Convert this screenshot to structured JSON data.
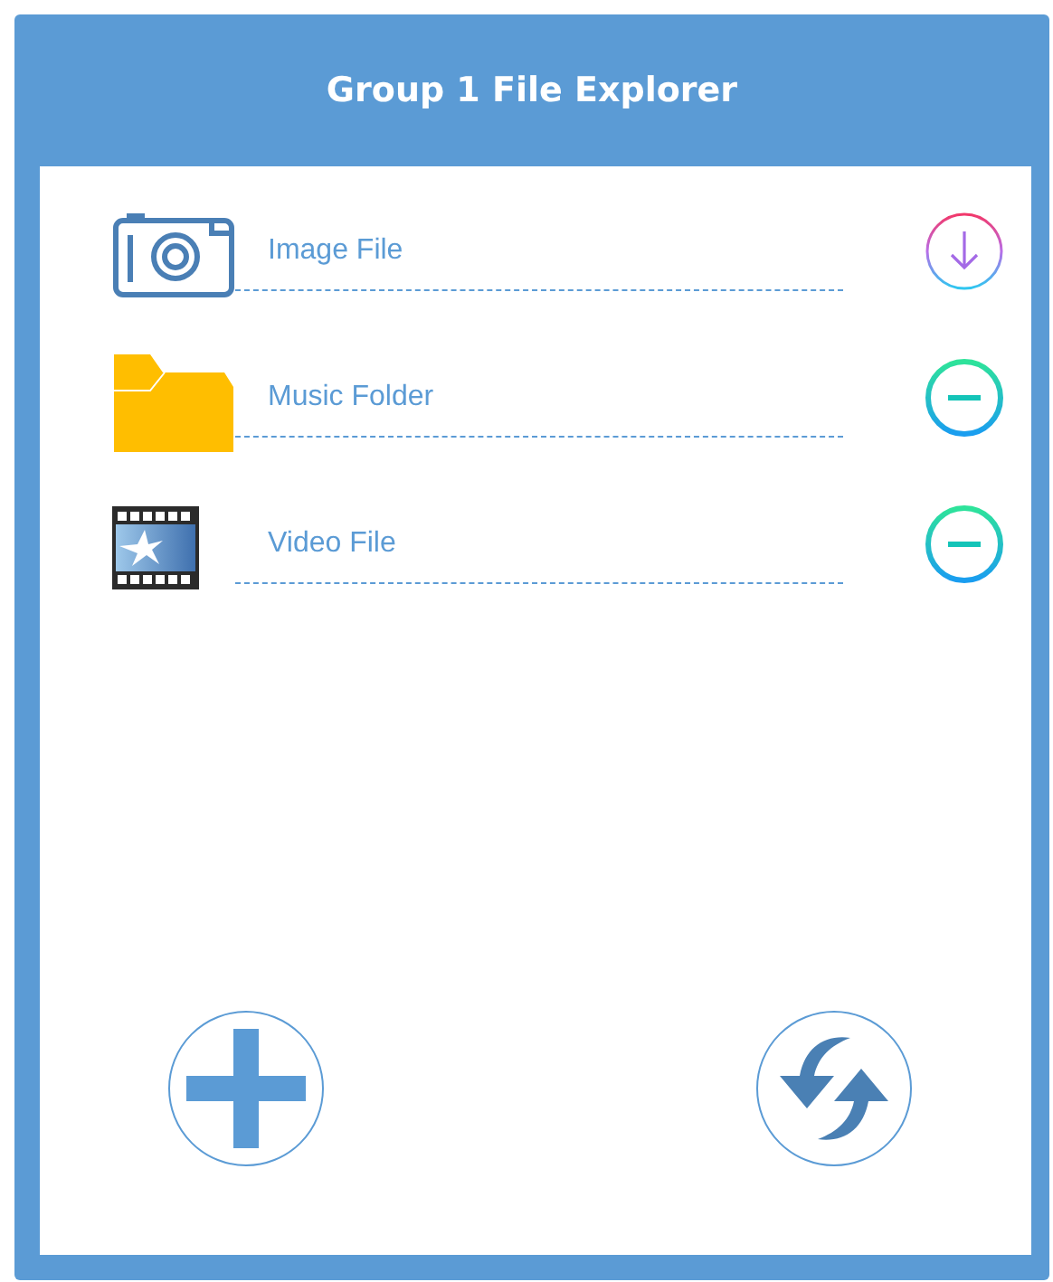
{
  "window": {
    "title": "Group 1 File Explorer"
  },
  "items": [
    {
      "kind": "image",
      "label": "Image File",
      "button": {
        "kind": "download"
      }
    },
    {
      "kind": "folder",
      "label": "Music Folder",
      "button": {
        "kind": "remove"
      }
    },
    {
      "kind": "video",
      "label": "Video File",
      "button": {
        "kind": "remove"
      }
    }
  ],
  "footer_buttons": [
    {
      "kind": "add"
    },
    {
      "kind": "refresh"
    }
  ]
}
